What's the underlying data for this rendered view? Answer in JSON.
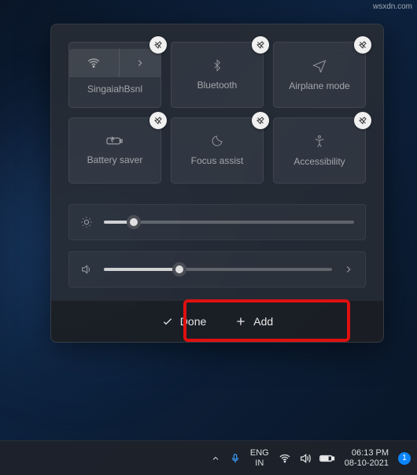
{
  "watermark": "wsxdn.com",
  "tiles": [
    {
      "id": "wifi",
      "label": "SingaiahBsnl"
    },
    {
      "id": "bluetooth",
      "label": "Bluetooth"
    },
    {
      "id": "airplane",
      "label": "Airplane mode"
    },
    {
      "id": "battery",
      "label": "Battery saver"
    },
    {
      "id": "focus",
      "label": "Focus assist"
    },
    {
      "id": "accessibility",
      "label": "Accessibility"
    }
  ],
  "sliders": {
    "brightness": {
      "percent": 12
    },
    "volume": {
      "percent": 33
    }
  },
  "actions": {
    "done": "Done",
    "add": "Add"
  },
  "taskbar": {
    "lang_top": "ENG",
    "lang_bottom": "IN",
    "time": "06:13 PM",
    "date": "08-10-2021",
    "notification_count": "1"
  }
}
